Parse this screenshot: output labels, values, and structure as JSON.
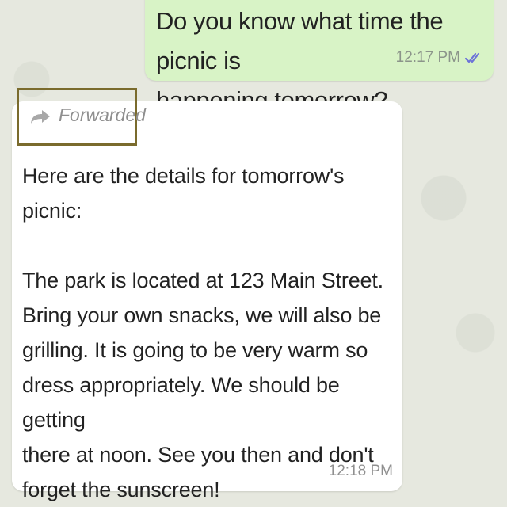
{
  "chat": {
    "outgoing": {
      "text": "Do you know what time the picnic is\nhappening tomorrow?",
      "time": "12:17 PM",
      "status_icon": "double-check-read-icon",
      "bubble_color": "#d8f3c6"
    },
    "incoming": {
      "forwarded_label": "Forwarded",
      "forward_icon": "forward-arrow-icon",
      "text": "Here are the details for tomorrow's picnic:\n\nThe park is located at 123 Main Street.\nBring your own snacks, we will also be\ngrilling. It is going to be very warm so\ndress appropriately. We should be getting\nthere at noon. See you then and don't\nforget the sunscreen!",
      "time": "12:18 PM",
      "bubble_color": "#ffffff"
    }
  },
  "colors": {
    "background": "#e6e8df",
    "tick_read": "#6c73d8",
    "highlight_border": "#7a6b2d"
  }
}
